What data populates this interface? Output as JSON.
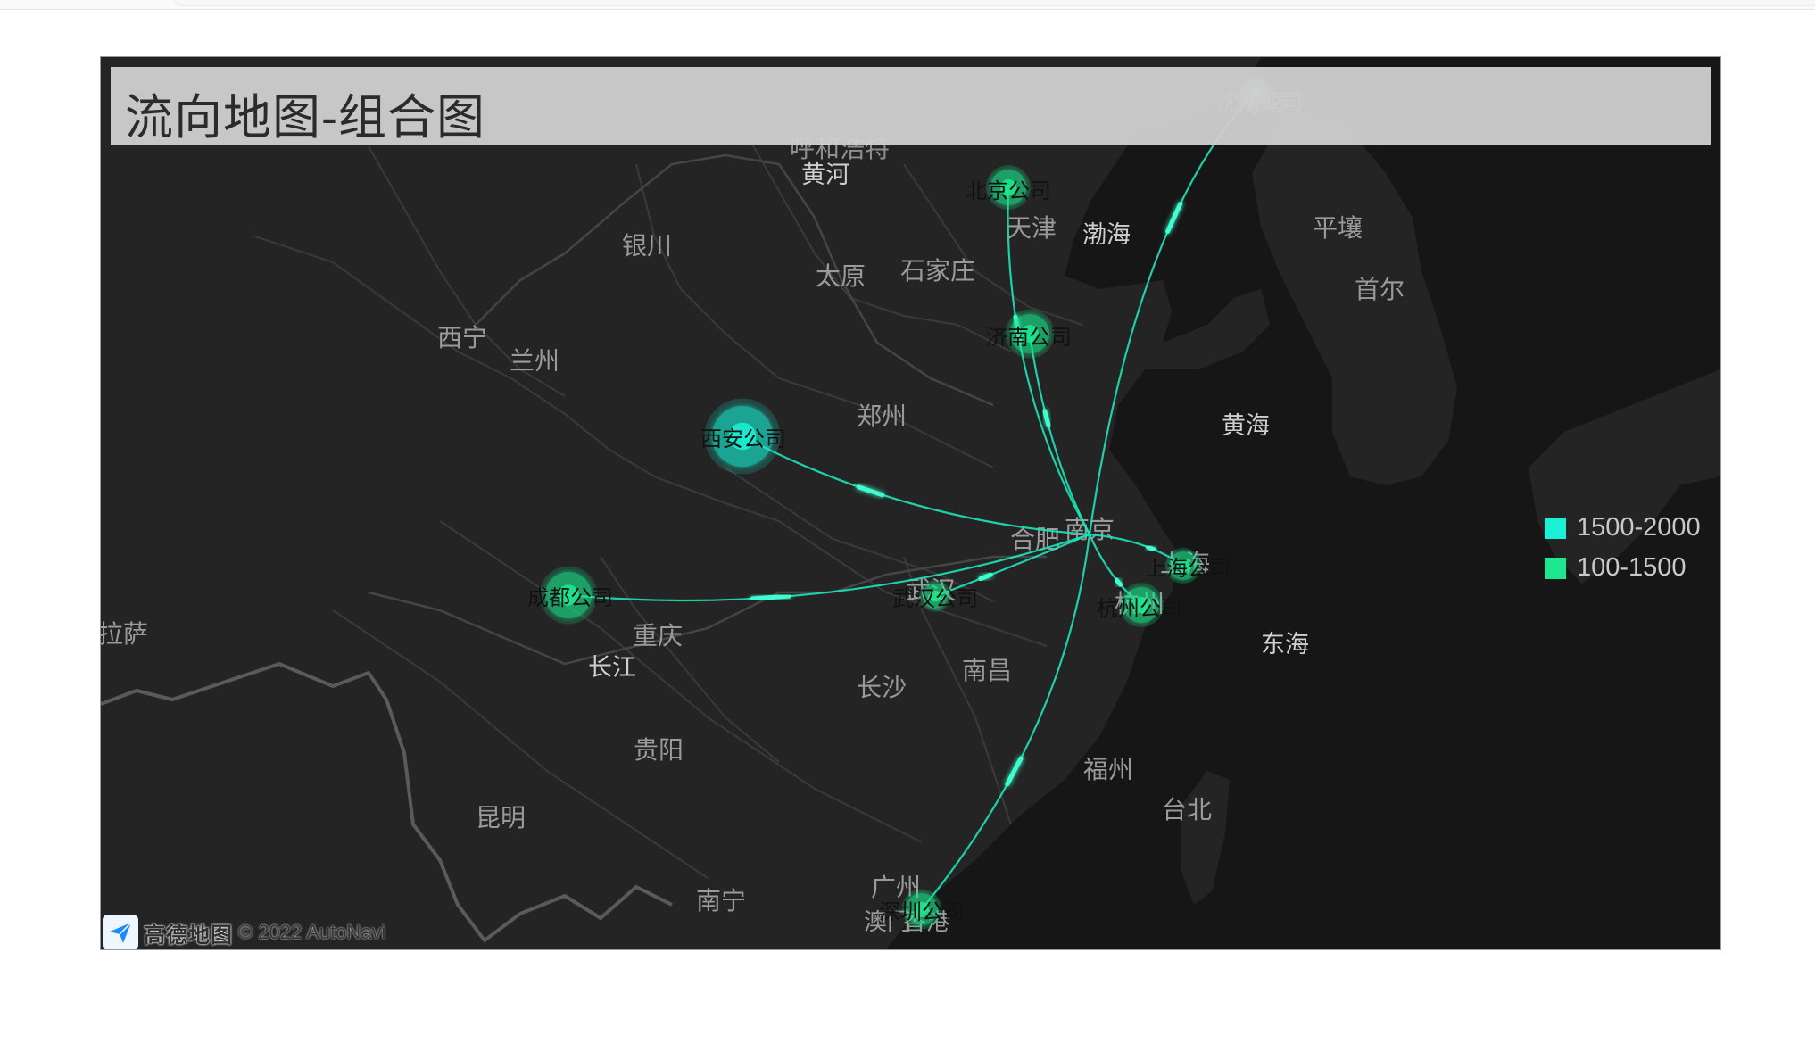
{
  "title": "流向地图-组合图",
  "attribution": {
    "brand": "高德地图",
    "copyright": "© 2022 AutoNavi"
  },
  "legend": [
    {
      "label": "1500-2000",
      "color": "#19f0d4"
    },
    {
      "label": "100-1500",
      "color": "#1be88e"
    }
  ],
  "base_labels": [
    "呼和浩特",
    "黄河",
    "银川",
    "太原",
    "石家庄",
    "天津",
    "渤海",
    "平壤",
    "首尔",
    "西宁",
    "兰州",
    "郑州",
    "黄海",
    "合肥",
    "南京",
    "上海",
    "杭州",
    "东海",
    "拉萨",
    "重庆",
    "长江",
    "武汉",
    "长沙",
    "南昌",
    "贵阳",
    "福州",
    "昆明",
    "台北",
    "广州",
    "南宁",
    "澳门",
    "香港",
    "沈阳"
  ],
  "hub": "南京",
  "companies": [
    {
      "name": "沈阳公司"
    },
    {
      "name": "北京公司"
    },
    {
      "name": "济南公司"
    },
    {
      "name": "西安公司"
    },
    {
      "name": "成都公司"
    },
    {
      "name": "武汉公司"
    },
    {
      "name": "上海公司"
    },
    {
      "name": "杭州公司"
    },
    {
      "name": "深圳公司"
    }
  ]
}
